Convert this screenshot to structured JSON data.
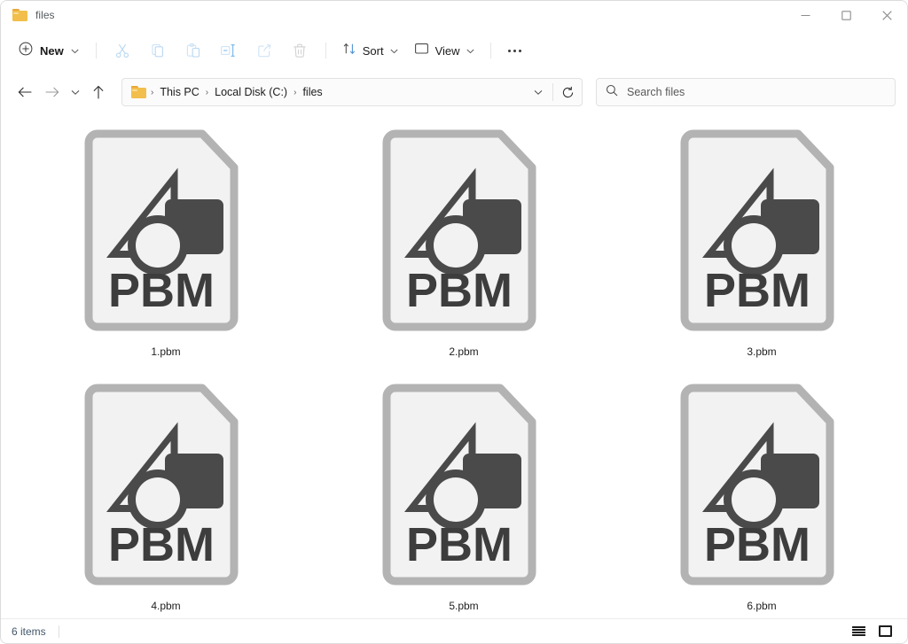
{
  "window": {
    "title": "files",
    "title_icon": "folder-icon",
    "controls": [
      {
        "name": "minimize-button",
        "glyph": "minimize-icon"
      },
      {
        "name": "maximize-button",
        "glyph": "maximize-icon"
      },
      {
        "name": "close-button",
        "glyph": "close-icon"
      }
    ]
  },
  "toolbar": {
    "new_label": "New",
    "new_icon": "plus-circle-icon",
    "sort_label": "Sort",
    "sort_icon": "sort-arrows-icon",
    "view_label": "View",
    "view_icon": "monitor-icon",
    "more_label": "See more",
    "more_icon": "ellipsis-icon",
    "actions": [
      {
        "name": "cut-button",
        "icon": "scissors-icon",
        "label": "Cut"
      },
      {
        "name": "copy-button",
        "icon": "copy-icon",
        "label": "Copy"
      },
      {
        "name": "paste-button",
        "icon": "paste-icon",
        "label": "Paste"
      },
      {
        "name": "rename-button",
        "icon": "rename-icon",
        "label": "Rename"
      },
      {
        "name": "share-button",
        "icon": "share-icon",
        "label": "Share"
      },
      {
        "name": "delete-button",
        "icon": "trash-icon",
        "label": "Delete"
      }
    ]
  },
  "nav": {
    "back_icon": "arrow-left-icon",
    "forward_icon": "arrow-right-icon",
    "recent_icon": "chevron-down-icon",
    "up_icon": "arrow-up-icon",
    "address_dropdown_icon": "chevron-down-icon",
    "refresh_icon": "refresh-icon",
    "breadcrumb_icon": "folder-icon",
    "breadcrumbs": [
      "This PC",
      "Local Disk (C:)",
      "files"
    ],
    "breadcrumb_separator": "›"
  },
  "search": {
    "placeholder": "Search files",
    "value": "",
    "icon": "search-icon"
  },
  "files": [
    {
      "name": "1.pbm",
      "type": "PBM",
      "icon": "pbm-file-icon"
    },
    {
      "name": "2.pbm",
      "type": "PBM",
      "icon": "pbm-file-icon"
    },
    {
      "name": "3.pbm",
      "type": "PBM",
      "icon": "pbm-file-icon"
    },
    {
      "name": "4.pbm",
      "type": "PBM",
      "icon": "pbm-file-icon"
    },
    {
      "name": "5.pbm",
      "type": "PBM",
      "icon": "pbm-file-icon"
    },
    {
      "name": "6.pbm",
      "type": "PBM",
      "icon": "pbm-file-icon"
    }
  ],
  "status": {
    "item_count": "6 items",
    "details_view_icon": "details-view-icon",
    "tiles_view_icon": "large-icons-view-icon"
  },
  "colors": {
    "accent": "#0078d4",
    "icon_border": "#b3b3b3",
    "icon_fill": "#f2f2f2",
    "glyph": "#4a4a4a",
    "label_text": "#1f1f1f",
    "status_text": "#43576b",
    "folder_yellow": "#f2bf4c"
  }
}
